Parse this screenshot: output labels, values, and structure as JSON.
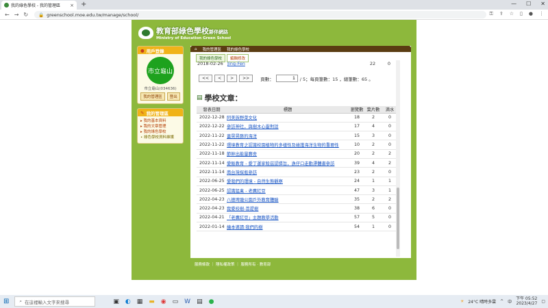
{
  "browser": {
    "tab_title": "我的綠色學校 - 我的管理區",
    "url": "greenschool.moe.edu.tw/manage/school/"
  },
  "site": {
    "logo_zh": "教育部綠色學校",
    "logo_zh_sub": "夥伴網路",
    "logo_en": "Ministry of Education Green School"
  },
  "sidebar": {
    "login_title": "用戶登錄",
    "avatar_text": "市立龜山",
    "user_id": "市立龜山(034636)",
    "btn_manage": "我的管理區",
    "btn_logout": "登出",
    "menu_title": "我的管理區",
    "menu": [
      "▸ 我的基本資料",
      "▸ 我的文章管理",
      "▸ 我的綠色學校",
      "• 綠色學校資料維護"
    ]
  },
  "breadcrumb": [
    "我的管理區",
    "我的綠色學校"
  ],
  "tabs": [
    "我的綠色學校",
    "編輯修改"
  ],
  "top_row": {
    "date": "2018-02-26",
    "author": "Jing-Fen",
    "views": "22",
    "count": "0"
  },
  "pager": {
    "first": "<<",
    "prev": "<",
    "next": ">",
    "last": ">>",
    "label": "頁數：",
    "value": "1",
    "info": "/ 5；每頁筆數：15 ，總筆數：65 。"
  },
  "section_title": "學校文章：",
  "table": {
    "headers": [
      "發表日期",
      "標題",
      "瀏覽數",
      "葉片數",
      "滴水"
    ],
    "rows": [
      [
        "2022-12-28",
        "阿美族野菜文化",
        "18",
        "2",
        "0"
      ],
      [
        "2022-12-22",
        "參訪神社，與樹木心靈對話",
        "17",
        "4",
        "0"
      ],
      [
        "2022-11-22",
        "蓋晃晃藝的海洋",
        "15",
        "3",
        "0"
      ],
      [
        "2022-11-22",
        "環境教育之認識校園植物的多樣性及維護海洋生物的重要性",
        "10",
        "2",
        "0"
      ],
      [
        "2022-11-18",
        "節幹出能量賽舍",
        "20",
        "2",
        "2"
      ],
      [
        "2022-11-14",
        "愛飯教育 - 愛丁運家殺茲認憐旨，漁仔口走動漂體畫參訪",
        "39",
        "4",
        "2"
      ],
      [
        "2022-11-14",
        "南台灣探瓶參訪",
        "23",
        "2",
        "0"
      ],
      [
        "2022-06-25",
        "愛我們的環境 - 自然生態觀察",
        "24",
        "1",
        "1"
      ],
      [
        "2022-06-25",
        "認識猛禽 - 老鷹紅豆",
        "47",
        "3",
        "1"
      ],
      [
        "2022-04-23",
        "八德埤塘公園戶外教育體驗",
        "35",
        "2",
        "2"
      ],
      [
        "2022-04-23",
        "我愛校樹-菩提樹",
        "38",
        "6",
        "0"
      ],
      [
        "2022-04-21",
        "「老鷹紅豆」主題教學活動",
        "57",
        "5",
        "0"
      ],
      [
        "2022-01-14",
        "繪本導讀:我們的樹",
        "54",
        "1",
        "0"
      ]
    ]
  },
  "footer": "服務條款 ｜ 隱私權政策 ｜ 服務所有 · 教育部",
  "taskbar": {
    "search_placeholder": "在這裡輸入文字來搜尋",
    "weather": "24°C 晴時多雲",
    "lang": "中",
    "time": "下午 05:52",
    "date": "2023/4/27"
  }
}
